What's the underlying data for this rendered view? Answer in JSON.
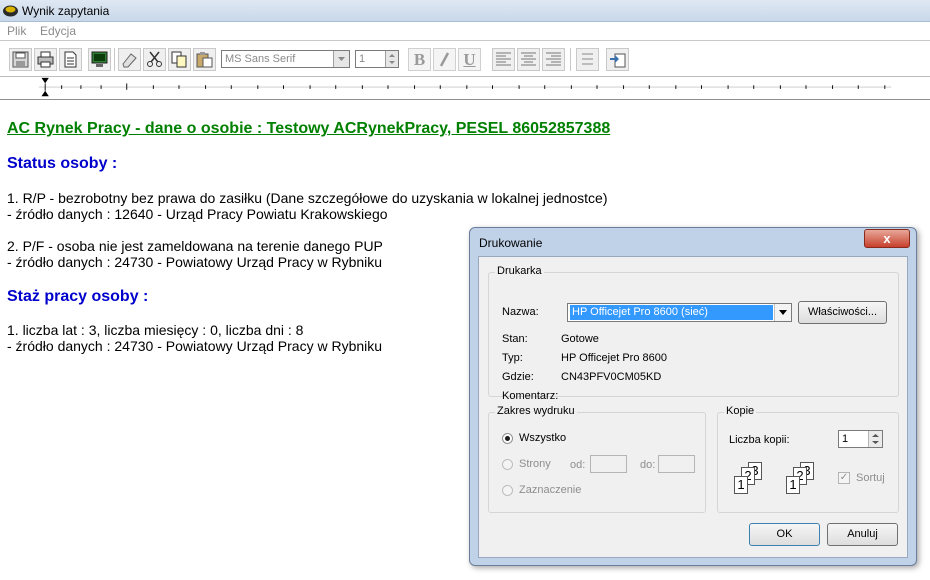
{
  "window": {
    "title": "Wynik zapytania"
  },
  "menu": [
    {
      "label": "Plik"
    },
    {
      "label": "Edycja"
    }
  ],
  "toolbar": {
    "font_name": "MS Sans Serif",
    "font_size": "1",
    "bold": "B",
    "italic": "I",
    "underline": "U"
  },
  "document": {
    "title": "AC Rynek Pracy - dane o osobie : Testowy ACRynekPracy, PESEL 86052857388",
    "status_heading": "Status osoby :",
    "status_items": [
      {
        "line1": "1. R/P - bezrobotny bez prawa do zasiłku (Dane szczegółowe do uzyskania w lokalnej jednostce)",
        "line2": " - źródło danych : 12640 - Urząd Pracy Powiatu Krakowskiego"
      },
      {
        "line1": "2. P/F - osoba nie jest zameldowana na terenie danego PUP",
        "line2": " - źródło danych : 24730 - Powiatowy Urząd Pracy w Rybniku"
      }
    ],
    "staz_heading": "Staż pracy osoby :",
    "staz_items": [
      {
        "line1": "1. liczba lat : 3, liczba miesięcy : 0, liczba dni : 8",
        "line2": " - źródło danych : 24730 - Powiatowy Urząd Pracy w Rybniku"
      }
    ]
  },
  "dialog": {
    "title": "Drukowanie",
    "close": "x",
    "printer_group": "Drukarka",
    "name_label": "Nazwa:",
    "printer_name": "HP Officejet Pro 8600 (sieć)",
    "properties_button": "Właściwości...",
    "status_label": "Stan:",
    "status_value": "Gotowe",
    "type_label": "Typ:",
    "type_value": "HP Officejet Pro 8600",
    "where_label": "Gdzie:",
    "where_value": "CN43PFV0CM05KD",
    "comment_label": "Komentarz:",
    "range_group": "Zakres wydruku",
    "range_all": "Wszystko",
    "range_pages": "Strony",
    "range_from": "od:",
    "range_to": "do:",
    "range_selection": "Zaznaczenie",
    "copies_group": "Kopie",
    "copies_label": "Liczba kopii:",
    "copies_value": "1",
    "collate_label": "Sortuj",
    "ok_button": "OK",
    "cancel_button": "Anuluj"
  }
}
